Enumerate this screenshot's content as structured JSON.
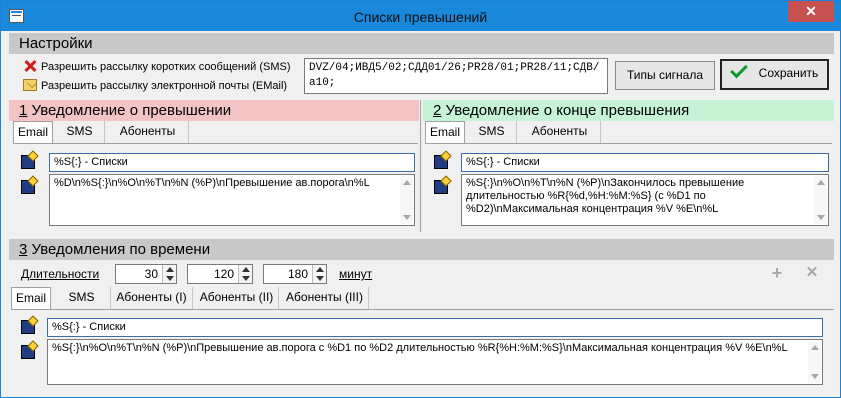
{
  "window": {
    "title": "Списки превышений",
    "close_label": "✕"
  },
  "settings": {
    "header": "Настройки",
    "sms_label": "Разрешить рассылку коротких сообщений (SMS)",
    "email_label": "Разрешить рассылку электронной почты (EMail)",
    "objects_text": "DVZ/04;ИВД5/02;СДД01/26;PR28/01;PR28/11;СДВ/а10;",
    "signal_types_button": "Типы сигнала",
    "save_button": "Сохранить"
  },
  "notify_start": {
    "num": "1",
    "header": "Уведомление о превышении",
    "tabs": [
      "Email",
      "SMS",
      "Абоненты"
    ],
    "active_tab": "Email",
    "subject": "%S{:} - Списки",
    "body": "%D\\n%S{:}\\n%O\\n%T\\n%N (%P)\\nПревышение ав.порога\\n%L"
  },
  "notify_end": {
    "num": "2",
    "header": "Уведомление о конце превышения",
    "tabs": [
      "Email",
      "SMS",
      "Абоненты"
    ],
    "active_tab": "Email",
    "subject": "%S{:} - Списки",
    "body": "%S{:}\\n%O\\n%T\\n%N (%P)\\nЗакончилось превышение длительностью %R{%d,%H:%M:%S} (с %D1 по %D2)\\nМаксимальная концентрация %V %E\\n%L"
  },
  "notify_time": {
    "num": "3",
    "header": "Уведомления по времени",
    "durations_label": "Длительности",
    "durations": [
      "30",
      "120",
      "180"
    ],
    "units_label": "минут",
    "add_icon": "plus-icon",
    "delete_icon": "x-icon",
    "tabs": [
      "Email",
      "SMS",
      "Абоненты (I)",
      "Абоненты (II)",
      "Абоненты (III)"
    ],
    "active_tab": "Email",
    "subject": "%S{:} - Списки",
    "body": "%S{:}\\n%O\\n%T\\n%N (%P)\\nПревышение ав.порога с %D1 по %D2 длительностью %R{%H:%M:%S}\\nМаксимальная концентрация %V %E\\n%L"
  },
  "colors": {
    "titlebar": "#1a88db",
    "close_button": "#c75050",
    "section_gray": "#c8c8c8",
    "section_red": "#f4c4c4",
    "section_green": "#c6f2d6"
  }
}
